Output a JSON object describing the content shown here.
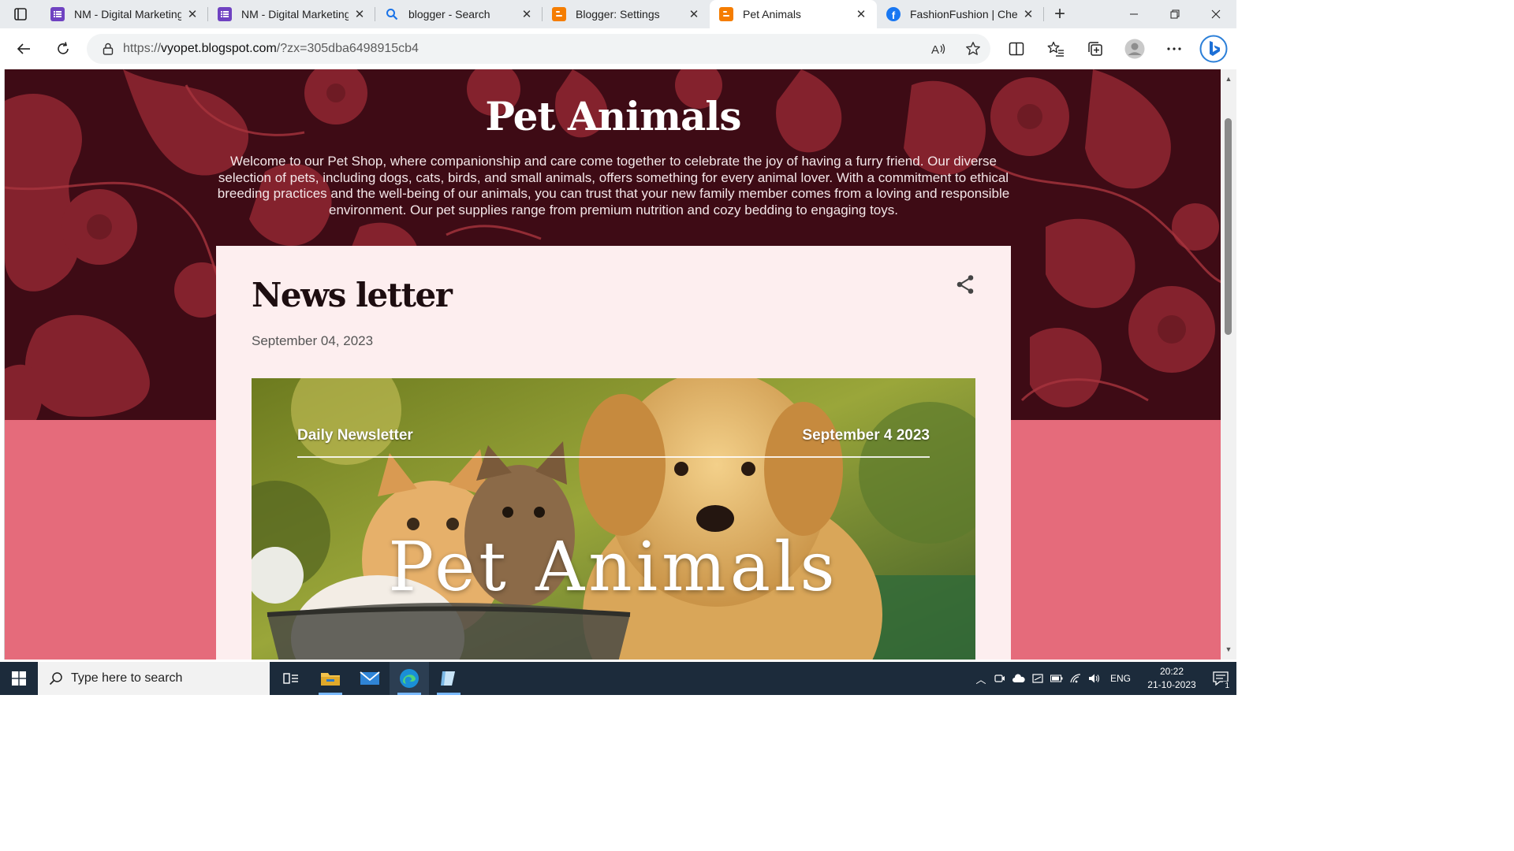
{
  "browser": {
    "tabs": [
      {
        "title": "NM - Digital Marketing",
        "favicon": "forms-icon",
        "color": "#6f42c1",
        "active": false
      },
      {
        "title": "NM - Digital Marketing",
        "favicon": "forms-icon",
        "color": "#6f42c1",
        "active": false
      },
      {
        "title": "blogger - Search",
        "favicon": "search-icon",
        "color": "#1a73e8",
        "active": false
      },
      {
        "title": "Blogger: Settings",
        "favicon": "blogger-icon",
        "color": "#f57d00",
        "active": false
      },
      {
        "title": "Pet Animals",
        "favicon": "blogger-icon",
        "color": "#f57d00",
        "active": true
      },
      {
        "title": "FashionFushion | Chenn",
        "favicon": "facebook-icon",
        "color": "#1877f2",
        "active": false
      }
    ],
    "address": {
      "scheme": "https://",
      "host": "vyopet.blogspot.com",
      "path": "/?zx=305dba6498915cb4"
    }
  },
  "blog": {
    "title": "Pet Animals",
    "description": "Welcome to our Pet Shop, where companionship and care come together to celebrate the joy of having a furry friend. Our diverse selection of pets, including dogs, cats, birds, and small animals, offers something for every animal lover. With a commitment to ethical breeding practices and the well-being of our animals, you can trust that your new family member comes from a loving and responsible environment. Our pet supplies range from premium nutrition and cozy bedding to engaging toys.",
    "colors": {
      "header_bg": "#3e0b15",
      "pattern": "#9b2d35",
      "page_bg": "#e56b7b",
      "card_bg": "#fdeeef"
    }
  },
  "post": {
    "title": "News letter",
    "date": "September 04, 2023",
    "image": {
      "left_caption": "Daily Newsletter",
      "right_caption": "September 4 2023",
      "overlay_title": "Pet Animals"
    }
  },
  "taskbar": {
    "search_placeholder": "Type here to search",
    "language": "ENG",
    "time": "20:22",
    "date": "21-10-2023",
    "notification_count": "1"
  }
}
